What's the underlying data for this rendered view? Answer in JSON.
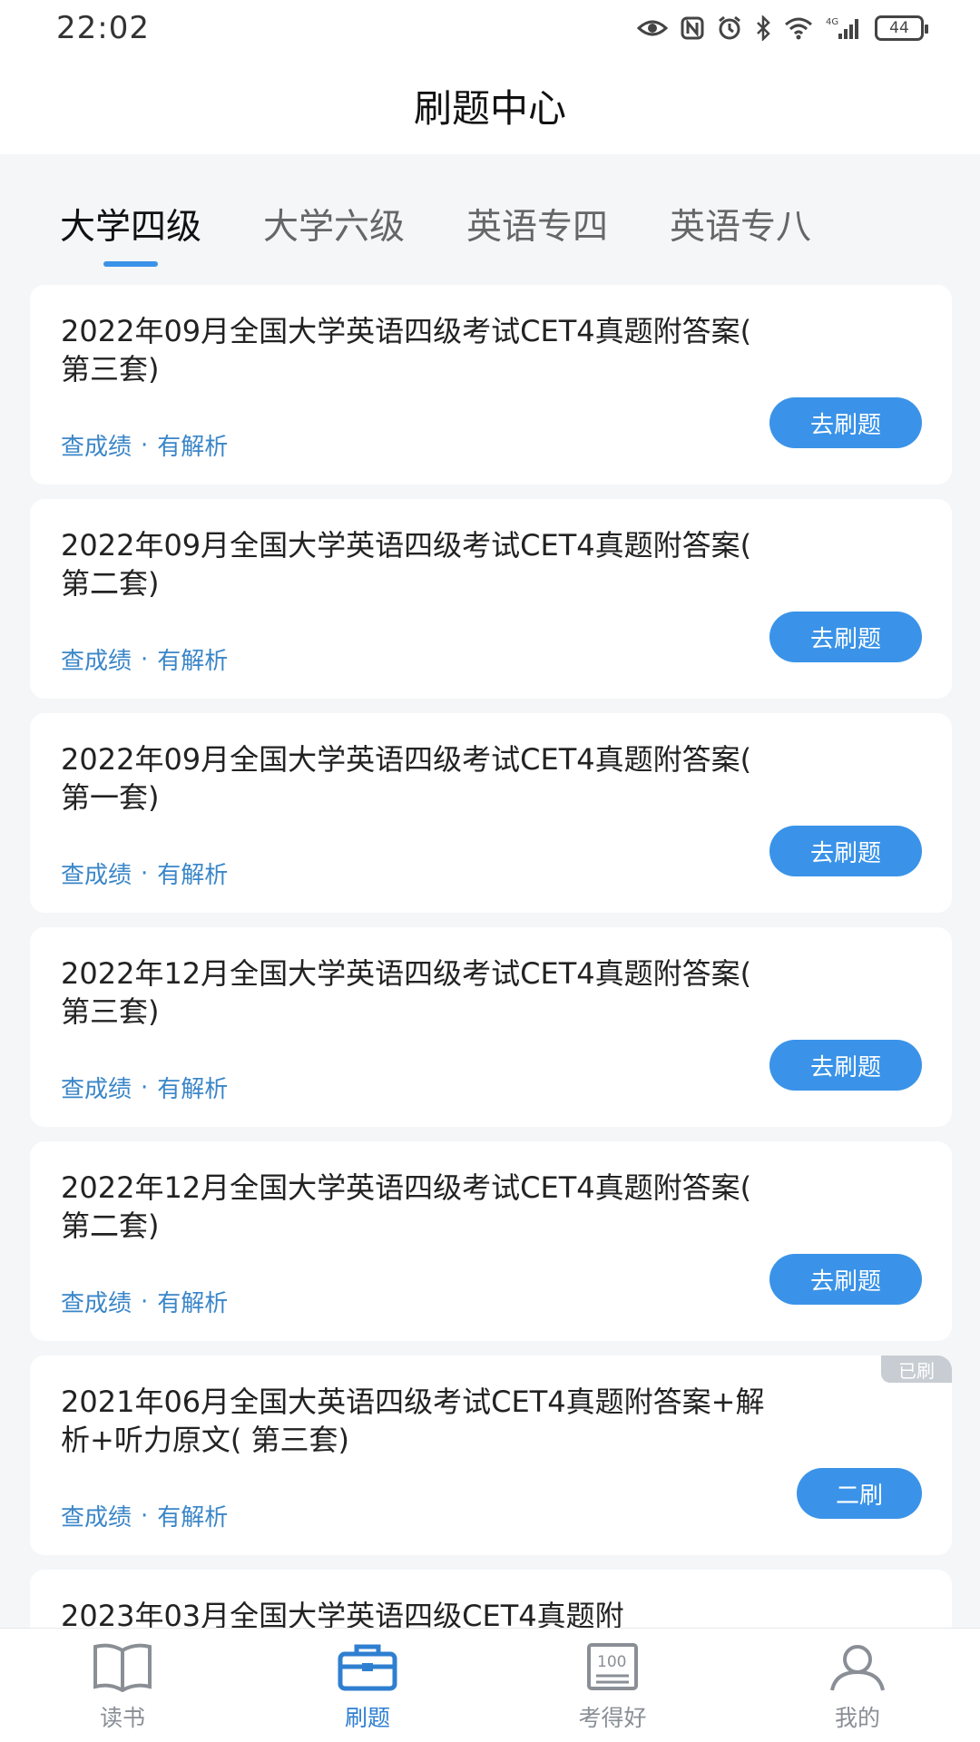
{
  "status_bar": {
    "time": "22:02",
    "battery": "44",
    "icons": [
      "eye-icon",
      "nfc-icon",
      "alarm-icon",
      "bluetooth-icon",
      "wifi-icon",
      "signal-4g-icon",
      "battery-icon"
    ],
    "network": "4G"
  },
  "header": {
    "title": "刷题中心"
  },
  "tabs": [
    {
      "label": "大学四级",
      "active": true
    },
    {
      "label": "大学六级",
      "active": false
    },
    {
      "label": "英语专四",
      "active": false
    },
    {
      "label": "英语专八",
      "active": false
    }
  ],
  "cards": [
    {
      "title": "2022年09月全国大学英语四级考试CET4真题附答案( 第三套)",
      "score_label": "查成绩",
      "separator": "·",
      "analysis_label": "有解析",
      "button": "去刷题",
      "done_badge": ""
    },
    {
      "title": "2022年09月全国大学英语四级考试CET4真题附答案( 第二套)",
      "score_label": "查成绩",
      "separator": "·",
      "analysis_label": "有解析",
      "button": "去刷题",
      "done_badge": ""
    },
    {
      "title": "2022年09月全国大学英语四级考试CET4真题附答案( 第一套)",
      "score_label": "查成绩",
      "separator": "·",
      "analysis_label": "有解析",
      "button": "去刷题",
      "done_badge": ""
    },
    {
      "title": "2022年12月全国大学英语四级考试CET4真题附答案( 第三套)",
      "score_label": "查成绩",
      "separator": "·",
      "analysis_label": "有解析",
      "button": "去刷题",
      "done_badge": ""
    },
    {
      "title": "2022年12月全国大学英语四级考试CET4真题附答案( 第二套)",
      "score_label": "查成绩",
      "separator": "·",
      "analysis_label": "有解析",
      "button": "去刷题",
      "done_badge": ""
    },
    {
      "title": "2021年06月全国大英语四级考试CET4真题附答案+解析+听力原文( 第三套)",
      "score_label": "查成绩",
      "separator": "·",
      "analysis_label": "有解析",
      "button": "二刷",
      "done_badge": "已刷"
    },
    {
      "title": "2023年03月全国大学英语四级CET4真题附",
      "score_label": "",
      "separator": "",
      "analysis_label": "",
      "button": "",
      "done_badge": ""
    }
  ],
  "bottom_nav": [
    {
      "label": "读书",
      "icon": "book-icon",
      "active": false
    },
    {
      "label": "刷题",
      "icon": "briefcase-icon",
      "active": true
    },
    {
      "label": "考得好",
      "icon": "score-100-icon",
      "active": false
    },
    {
      "label": "我的",
      "icon": "person-icon",
      "active": false
    }
  ],
  "colors": {
    "accent": "#3a93e8",
    "meta_text": "#3a86c8",
    "badge": "#c8cdd3",
    "background": "#f4f6f8"
  }
}
